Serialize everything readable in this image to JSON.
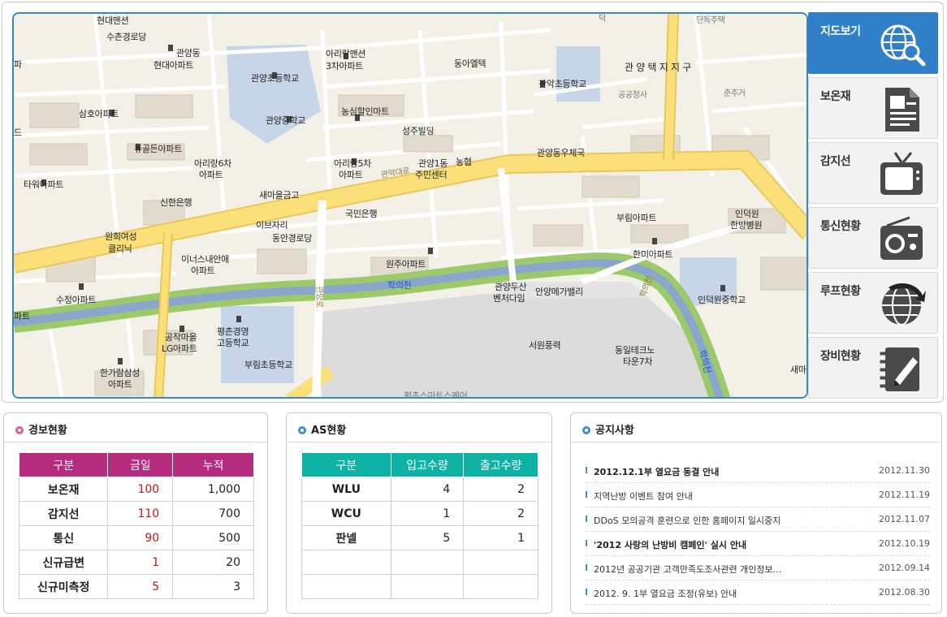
{
  "nav": {
    "items": [
      {
        "label": "지도보기",
        "icon": "globe-search-icon",
        "active": true
      },
      {
        "label": "보온재",
        "icon": "document-icon",
        "active": false
      },
      {
        "label": "감지선",
        "icon": "television-icon",
        "active": false
      },
      {
        "label": "통신현황",
        "icon": "radio-icon",
        "active": false
      },
      {
        "label": "루프현황",
        "icon": "globe-arrow-icon",
        "active": false
      },
      {
        "label": "장비현황",
        "icon": "notebook-pen-icon",
        "active": false
      }
    ]
  },
  "map": {
    "labels": {
      "l01": "현대맨션",
      "l02": "수촌경로당",
      "l03": "관양동",
      "l04": "현대아파트",
      "l05": "아리랑맨션",
      "l06": "3차아파트",
      "l07": "관양초등학교",
      "l08": "동아엘텍",
      "l09": "관악초등학교",
      "l10": "관 양 택 지 지 구",
      "l11": "공공청사",
      "l12": "준주거",
      "l13": "단독주택",
      "l14": "삼호아파트",
      "l15": "농심할인마트",
      "l16": "관양중학교",
      "l17": "성주빌딩",
      "l18": "뉴골든아파트",
      "l19": "아리랑6차",
      "l20": "아파트",
      "l21": "아리랑5차",
      "l22": "아파트",
      "l23": "관양1동",
      "l24": "주민센터",
      "l25": "농협",
      "l26": "관양동우체국",
      "l27": "타워아파트",
      "l28": "신한은행",
      "l29": "새마을금고",
      "l30": "국민은행",
      "l31": "인덕원",
      "l32": "한방병원",
      "l33": "원희여성",
      "l34": "클리닉",
      "l35": "이브자리",
      "l36": "동안경로당",
      "l37": "부림아파트",
      "l38": "이너스내안애",
      "l39": "아파트",
      "l40": "원주아파트",
      "l41": "한미아파트",
      "l42": "수정아파트",
      "l43": "학의천",
      "l44": "관양두산",
      "l45": "벤처다임",
      "l46": "안양메가밸리",
      "l47": "인덕원중학교",
      "l48": "파트",
      "l49": "공작마을",
      "l50": "LG아파트",
      "l51": "평촌경영",
      "l52": "고등학교",
      "l53": "서원풍력",
      "l54": "동일테크노",
      "l55": "타운7차",
      "l56": "부림초등학교",
      "l57": "한가람삼성",
      "l58": "아파트",
      "l59": "새마",
      "l60": "관악대로",
      "l61": "학의천",
      "l62": "관양로",
      "l63": "평촌스마트스퀘어",
      "l64": "학의천",
      "l65": "덕",
      "l66": "파",
      "l67": "드"
    }
  },
  "alarm": {
    "title": "경보현황",
    "headers": [
      "구분",
      "금일",
      "누적"
    ],
    "rows": [
      {
        "name": "보온재",
        "today": "100",
        "total": "1,000"
      },
      {
        "name": "감지선",
        "today": "110",
        "total": "700"
      },
      {
        "name": "통신",
        "today": "90",
        "total": "500"
      },
      {
        "name": "신규급변",
        "today": "1",
        "total": "20"
      },
      {
        "name": "신규미측정",
        "today": "5",
        "total": "3"
      }
    ],
    "accent": "#b52c7f"
  },
  "as": {
    "title": "AS현황",
    "headers": [
      "구분",
      "입고수량",
      "출고수량"
    ],
    "rows": [
      {
        "name": "WLU",
        "in": "4",
        "out": "2"
      },
      {
        "name": "WCU",
        "in": "1",
        "out": "2"
      },
      {
        "name": "판넬",
        "in": "5",
        "out": "1"
      }
    ],
    "accent": "#0fb3a6"
  },
  "notice": {
    "title": "공지사항",
    "items": [
      {
        "title": "2012.12.1부 열요금 동결 안내",
        "date": "2012.11.30"
      },
      {
        "title": "지역난방 이벤트 참여 안내",
        "date": "2012.11.19"
      },
      {
        "title": "DDoS 모의공격 훈련으로 인한 홈페이지 일시중지",
        "date": "2012.11.07"
      },
      {
        "title": "'2012 사랑의 난방비 캠페인' 실시 안내",
        "date": "2012.10.19"
      },
      {
        "title": "2012년 공공기관 고객만족도조사관련 개인정보...",
        "date": "2012.09.14"
      },
      {
        "title": "2012. 9. 1부 열요금 조정(유보) 안내",
        "date": "2012.08.30"
      }
    ]
  }
}
